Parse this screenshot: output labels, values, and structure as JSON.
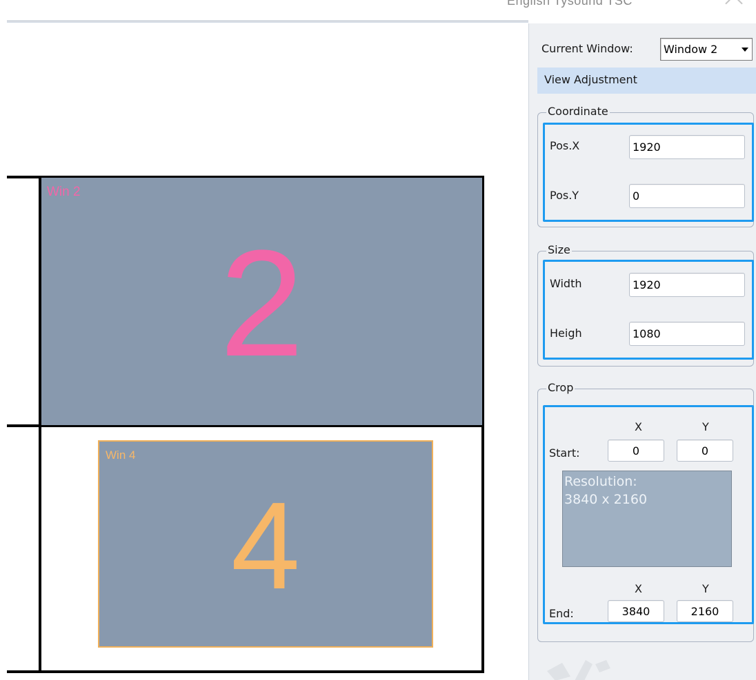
{
  "topbar": {
    "truncated_text": "English  Tysound  TSC"
  },
  "windows": [
    {
      "label": "Win 2",
      "number": "2",
      "color": "#f266a8"
    },
    {
      "label": "Win 4",
      "number": "4",
      "color": "#f7b768"
    }
  ],
  "panel": {
    "current_window_label": "Current Window:",
    "current_window_value": "Window 2",
    "view_adjustment_label": "View Adjustment",
    "coordinate": {
      "title": "Coordinate",
      "pos_x_label": "Pos.X",
      "pos_x_value": "1920",
      "pos_y_label": "Pos.Y",
      "pos_y_value": "0"
    },
    "size": {
      "title": "Size",
      "width_label": "Width",
      "width_value": "1920",
      "height_label": "Heigh",
      "height_value": "1080"
    },
    "crop": {
      "title": "Crop",
      "x_header": "X",
      "y_header": "Y",
      "start_label": "Start:",
      "start_x": "0",
      "start_y": "0",
      "resolution_label": "Resolution:",
      "resolution_value": "3840 x 2160",
      "end_label": "End:",
      "end_x": "3840",
      "end_y": "2160"
    }
  },
  "colors": {
    "accent_blue": "#1e9bf0",
    "window_fill": "#8899ae",
    "view_adjustment_bg": "#cfe0f4"
  }
}
